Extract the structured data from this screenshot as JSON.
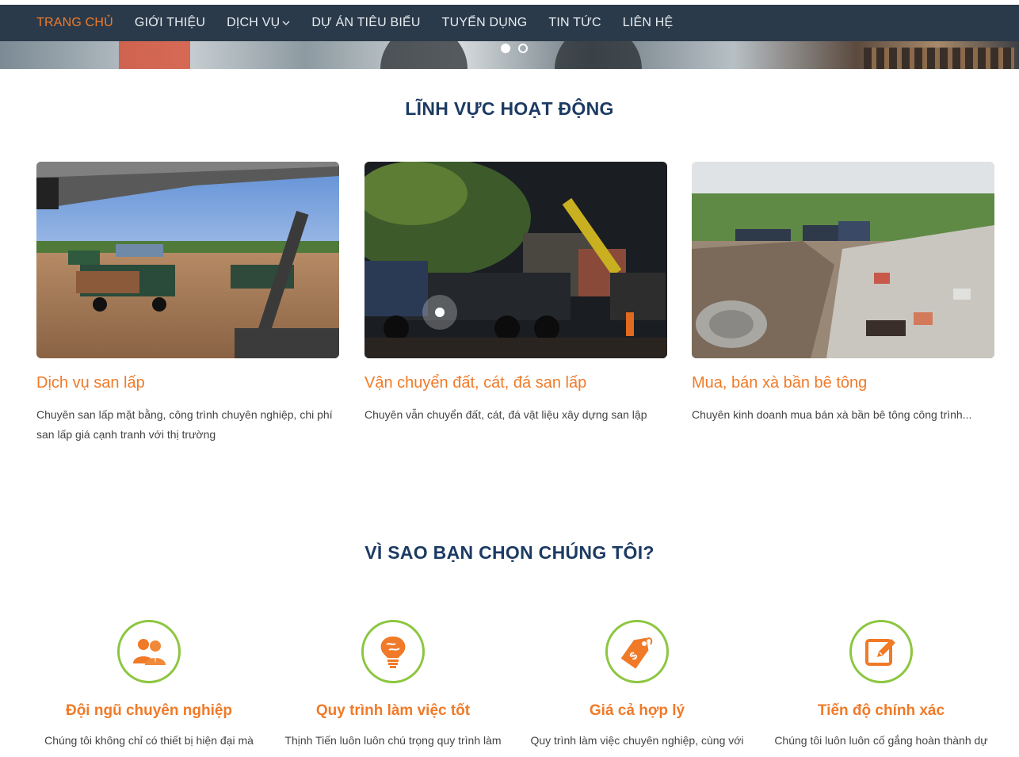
{
  "nav": {
    "items": [
      {
        "label": "TRANG CHỦ"
      },
      {
        "label": "GIỚI THIỆU"
      },
      {
        "label": "DỊCH VỤ"
      },
      {
        "label": "DỰ ÁN TIÊU BIỂU"
      },
      {
        "label": "TUYỂN DỤNG"
      },
      {
        "label": "TIN TỨC"
      },
      {
        "label": "LIÊN HỆ"
      }
    ],
    "active_color": "#f07a28",
    "background": "#2b3a4a"
  },
  "sections": {
    "fields_title": "LĨNH VỰC HOẠT ĐỘNG",
    "why_title": "VÌ SAO BẠN CHỌN CHÚNG TÔI?"
  },
  "cards": [
    {
      "title": "Dịch vụ san lấp",
      "desc": "Chuyên san lấp mặt bằng, công trình chuyên nghiệp, chi phí san lấp giá cạnh tranh với thị trường"
    },
    {
      "title": "Vận chuyển đất, cát, đá san lấp",
      "desc": "Chuyên vẫn chuyển đất, cát, đá vật liệu xây dựng san lập"
    },
    {
      "title": "Mua, bán xà bần bê tông",
      "desc": "Chuyên kinh doanh mua bán xà bần bê tông công trình..."
    }
  ],
  "features": [
    {
      "icon": "team-icon",
      "title": "Đội ngũ chuyên nghiệp",
      "desc": "Chúng tôi không chỉ có thiết bị hiện đại mà"
    },
    {
      "icon": "brain-bulb-icon",
      "title": "Quy trình làm việc tốt",
      "desc": "Thịnh Tiến luôn luôn chú trọng quy trình làm"
    },
    {
      "icon": "price-tag-icon",
      "title": "Giá cả hợp lý",
      "desc": "Quy trình làm việc chuyên nghiệp, cùng với"
    },
    {
      "icon": "edit-icon",
      "title": "Tiến độ chính xác",
      "desc": "Chúng tôi luôn luôn cố gắng hoàn thành dự"
    }
  ],
  "colors": {
    "accent": "#f07a28",
    "heading": "#1c3b63",
    "icon_ring": "#8cc63f"
  }
}
